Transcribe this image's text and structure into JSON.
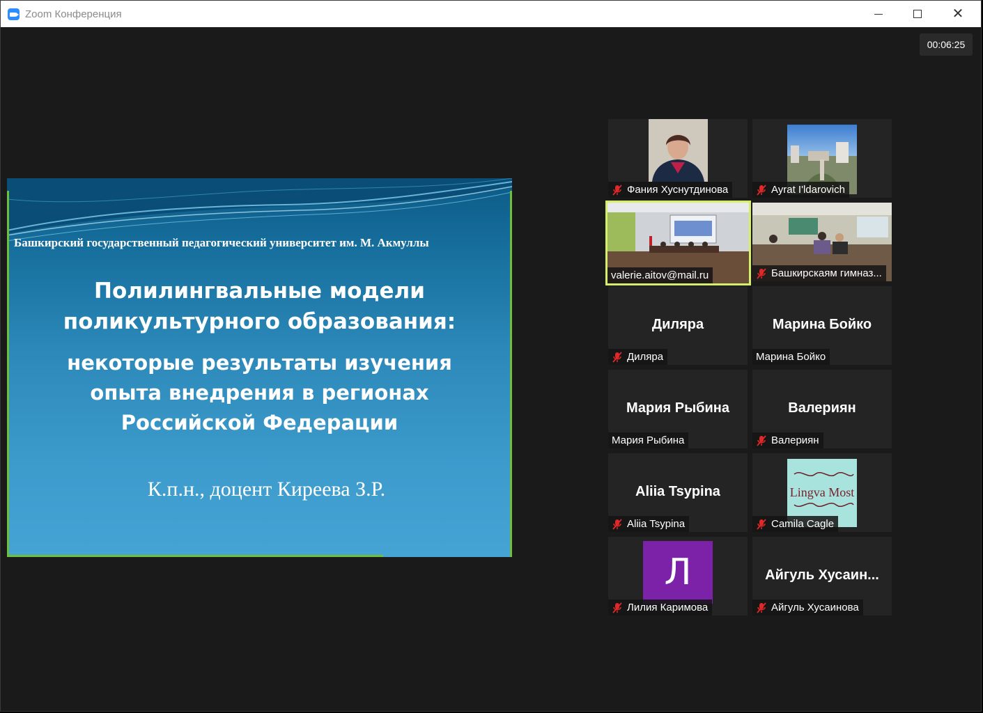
{
  "window": {
    "title": "Zoom Конференция",
    "icon": "zoom-camera-icon"
  },
  "timer": "00:06:25",
  "slide": {
    "university": "Башкирский государственный педагогический университет им. М. Акмуллы",
    "title_line1": "Полилингвальные модели",
    "title_line2": "поликультурного образования:",
    "subtitle_line1": "некоторые результаты изучения",
    "subtitle_line2": "опыта внедрения в регионах",
    "subtitle_line3": "Российской Федерации",
    "author": "К.п.н., доцент Киреева З.Р."
  },
  "participants": [
    {
      "name": "Фания Хуснутдинова",
      "muted": true,
      "video": "photo-woman"
    },
    {
      "name": "Ayrat I'ldarovich",
      "muted": true,
      "video": "photo-city"
    },
    {
      "name": "valerie.aitov@mail.ru",
      "muted": false,
      "video": "conference-room",
      "active": true
    },
    {
      "name": "Башкирскаям гимназ...",
      "muted": true,
      "video": "classroom"
    },
    {
      "name": "Диляра",
      "display": "Диляра",
      "muted": true
    },
    {
      "name": "Марина Бойко",
      "display": "Марина Бойко",
      "muted": false
    },
    {
      "name": "Мария Рыбина",
      "display": "Мария Рыбина",
      "muted": false
    },
    {
      "name": "Валериян",
      "display": "Валериян",
      "muted": true
    },
    {
      "name": "Aliia Tsypina",
      "display": "Aliia Tsypina",
      "muted": true
    },
    {
      "name": "Camila Cagle",
      "muted": true,
      "video": "logo",
      "logo_text": "Lingva Most"
    },
    {
      "name": "Лилия Каримова",
      "muted": true,
      "avatar_letter": "Л",
      "avatar_color": "#7b22a8"
    },
    {
      "name": "Айгуль Хусаинова",
      "display": "Айгуль  Хусаин...",
      "muted": true
    }
  ],
  "colors": {
    "mute_red": "#e02828",
    "active_speaker": "#d5ef6d",
    "slide_green": "#6fbf3a"
  }
}
